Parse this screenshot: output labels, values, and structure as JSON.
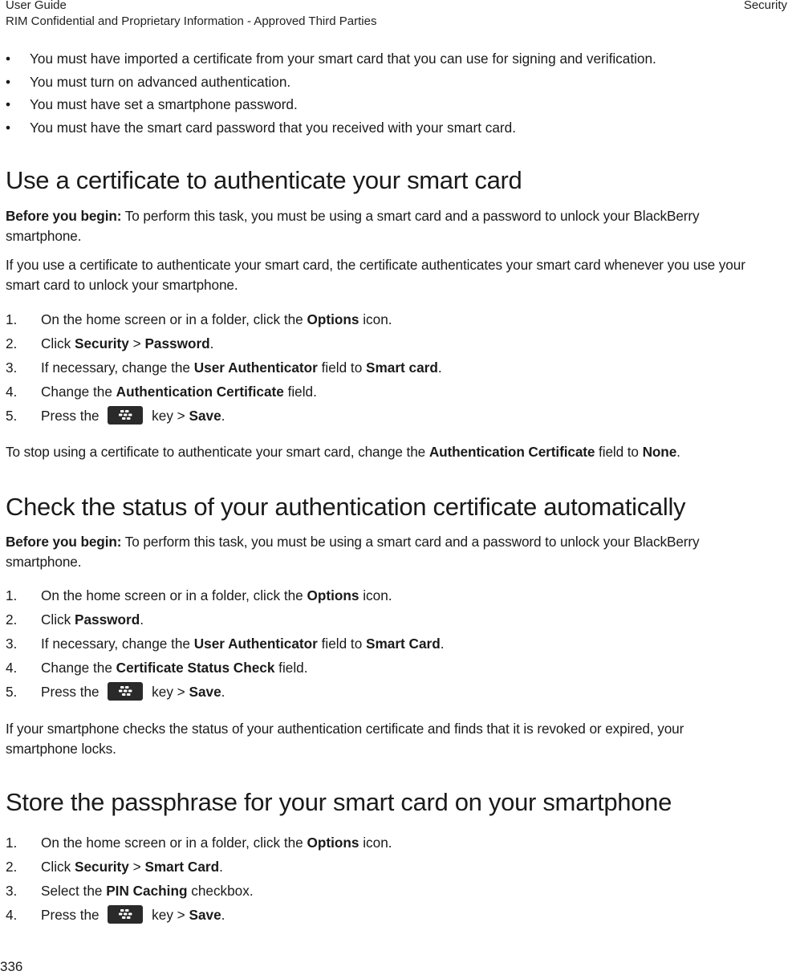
{
  "header": {
    "left_line1": "User Guide",
    "left_line2": "RIM Confidential and Proprietary Information - Approved Third Parties",
    "right": "Security"
  },
  "prereqs": [
    "You must have imported a certificate from your smart card that you can use for signing and verification.",
    "You must turn on advanced authentication.",
    "You must have set a smartphone password.",
    "You must have the smart card password that you received with your smart card."
  ],
  "section1": {
    "title": "Use a certificate to authenticate your smart card",
    "before_label": "Before you begin:",
    "before_text": " To perform this task, you must be using a smart card and a password to unlock your BlackBerry smartphone.",
    "intro": "If you use a certificate to authenticate your smart card, the certificate authenticates your smart card whenever you use your smart card to unlock your smartphone.",
    "steps": [
      {
        "num": "1.",
        "parts": [
          [
            "On the home screen or in a folder, click the ",
            false
          ],
          [
            "Options",
            true
          ],
          [
            " icon.",
            false
          ]
        ]
      },
      {
        "num": "2.",
        "parts": [
          [
            "Click ",
            false
          ],
          [
            "Security",
            true
          ],
          [
            " > ",
            false
          ],
          [
            "Password",
            true
          ],
          [
            ".",
            false
          ]
        ]
      },
      {
        "num": "3.",
        "parts": [
          [
            "If necessary, change the ",
            false
          ],
          [
            "User Authenticator",
            true
          ],
          [
            " field to ",
            false
          ],
          [
            "Smart card",
            true
          ],
          [
            ".",
            false
          ]
        ]
      },
      {
        "num": "4.",
        "parts": [
          [
            "Change the ",
            false
          ],
          [
            "Authentication Certificate",
            true
          ],
          [
            " field.",
            false
          ]
        ]
      },
      {
        "num": "5.",
        "key": true,
        "pre": "Press the ",
        "post": " key > ",
        "bold": "Save",
        "end": "."
      }
    ],
    "outro": [
      [
        "To stop using a certificate to authenticate your smart card, change the ",
        false
      ],
      [
        "Authentication Certificate",
        true
      ],
      [
        " field to ",
        false
      ],
      [
        "None",
        true
      ],
      [
        ".",
        false
      ]
    ]
  },
  "section2": {
    "title": "Check the status of your authentication certificate automatically",
    "before_label": "Before you begin:",
    "before_text": " To perform this task, you must be using a smart card and a password to unlock your BlackBerry smartphone.",
    "steps": [
      {
        "num": "1.",
        "parts": [
          [
            "On the home screen or in a folder, click the ",
            false
          ],
          [
            "Options",
            true
          ],
          [
            " icon.",
            false
          ]
        ]
      },
      {
        "num": "2.",
        "parts": [
          [
            "Click ",
            false
          ],
          [
            "Password",
            true
          ],
          [
            ".",
            false
          ]
        ]
      },
      {
        "num": "3.",
        "parts": [
          [
            "If necessary, change the ",
            false
          ],
          [
            "User Authenticator",
            true
          ],
          [
            " field to ",
            false
          ],
          [
            "Smart Card",
            true
          ],
          [
            ".",
            false
          ]
        ]
      },
      {
        "num": "4.",
        "parts": [
          [
            "Change the ",
            false
          ],
          [
            "Certificate Status Check",
            true
          ],
          [
            " field.",
            false
          ]
        ]
      },
      {
        "num": "5.",
        "key": true,
        "pre": "Press the ",
        "post": " key > ",
        "bold": "Save",
        "end": "."
      }
    ],
    "outro": "If your smartphone checks the status of your authentication certificate and finds that it is revoked or expired, your smartphone locks."
  },
  "section3": {
    "title": "Store the passphrase for your smart card on your smartphone",
    "steps": [
      {
        "num": "1.",
        "parts": [
          [
            "On the home screen or in a folder, click the ",
            false
          ],
          [
            "Options",
            true
          ],
          [
            " icon.",
            false
          ]
        ]
      },
      {
        "num": "2.",
        "parts": [
          [
            "Click ",
            false
          ],
          [
            "Security",
            true
          ],
          [
            " > ",
            false
          ],
          [
            "Smart Card",
            true
          ],
          [
            ".",
            false
          ]
        ]
      },
      {
        "num": "3.",
        "parts": [
          [
            "Select the ",
            false
          ],
          [
            "PIN Caching",
            true
          ],
          [
            " checkbox.",
            false
          ]
        ]
      },
      {
        "num": "4.",
        "key": true,
        "pre": "Press the ",
        "post": " key > ",
        "bold": "Save",
        "end": "."
      }
    ]
  },
  "icons": {
    "menu_key": "blackberry-menu-key-icon"
  },
  "page_number": "336"
}
